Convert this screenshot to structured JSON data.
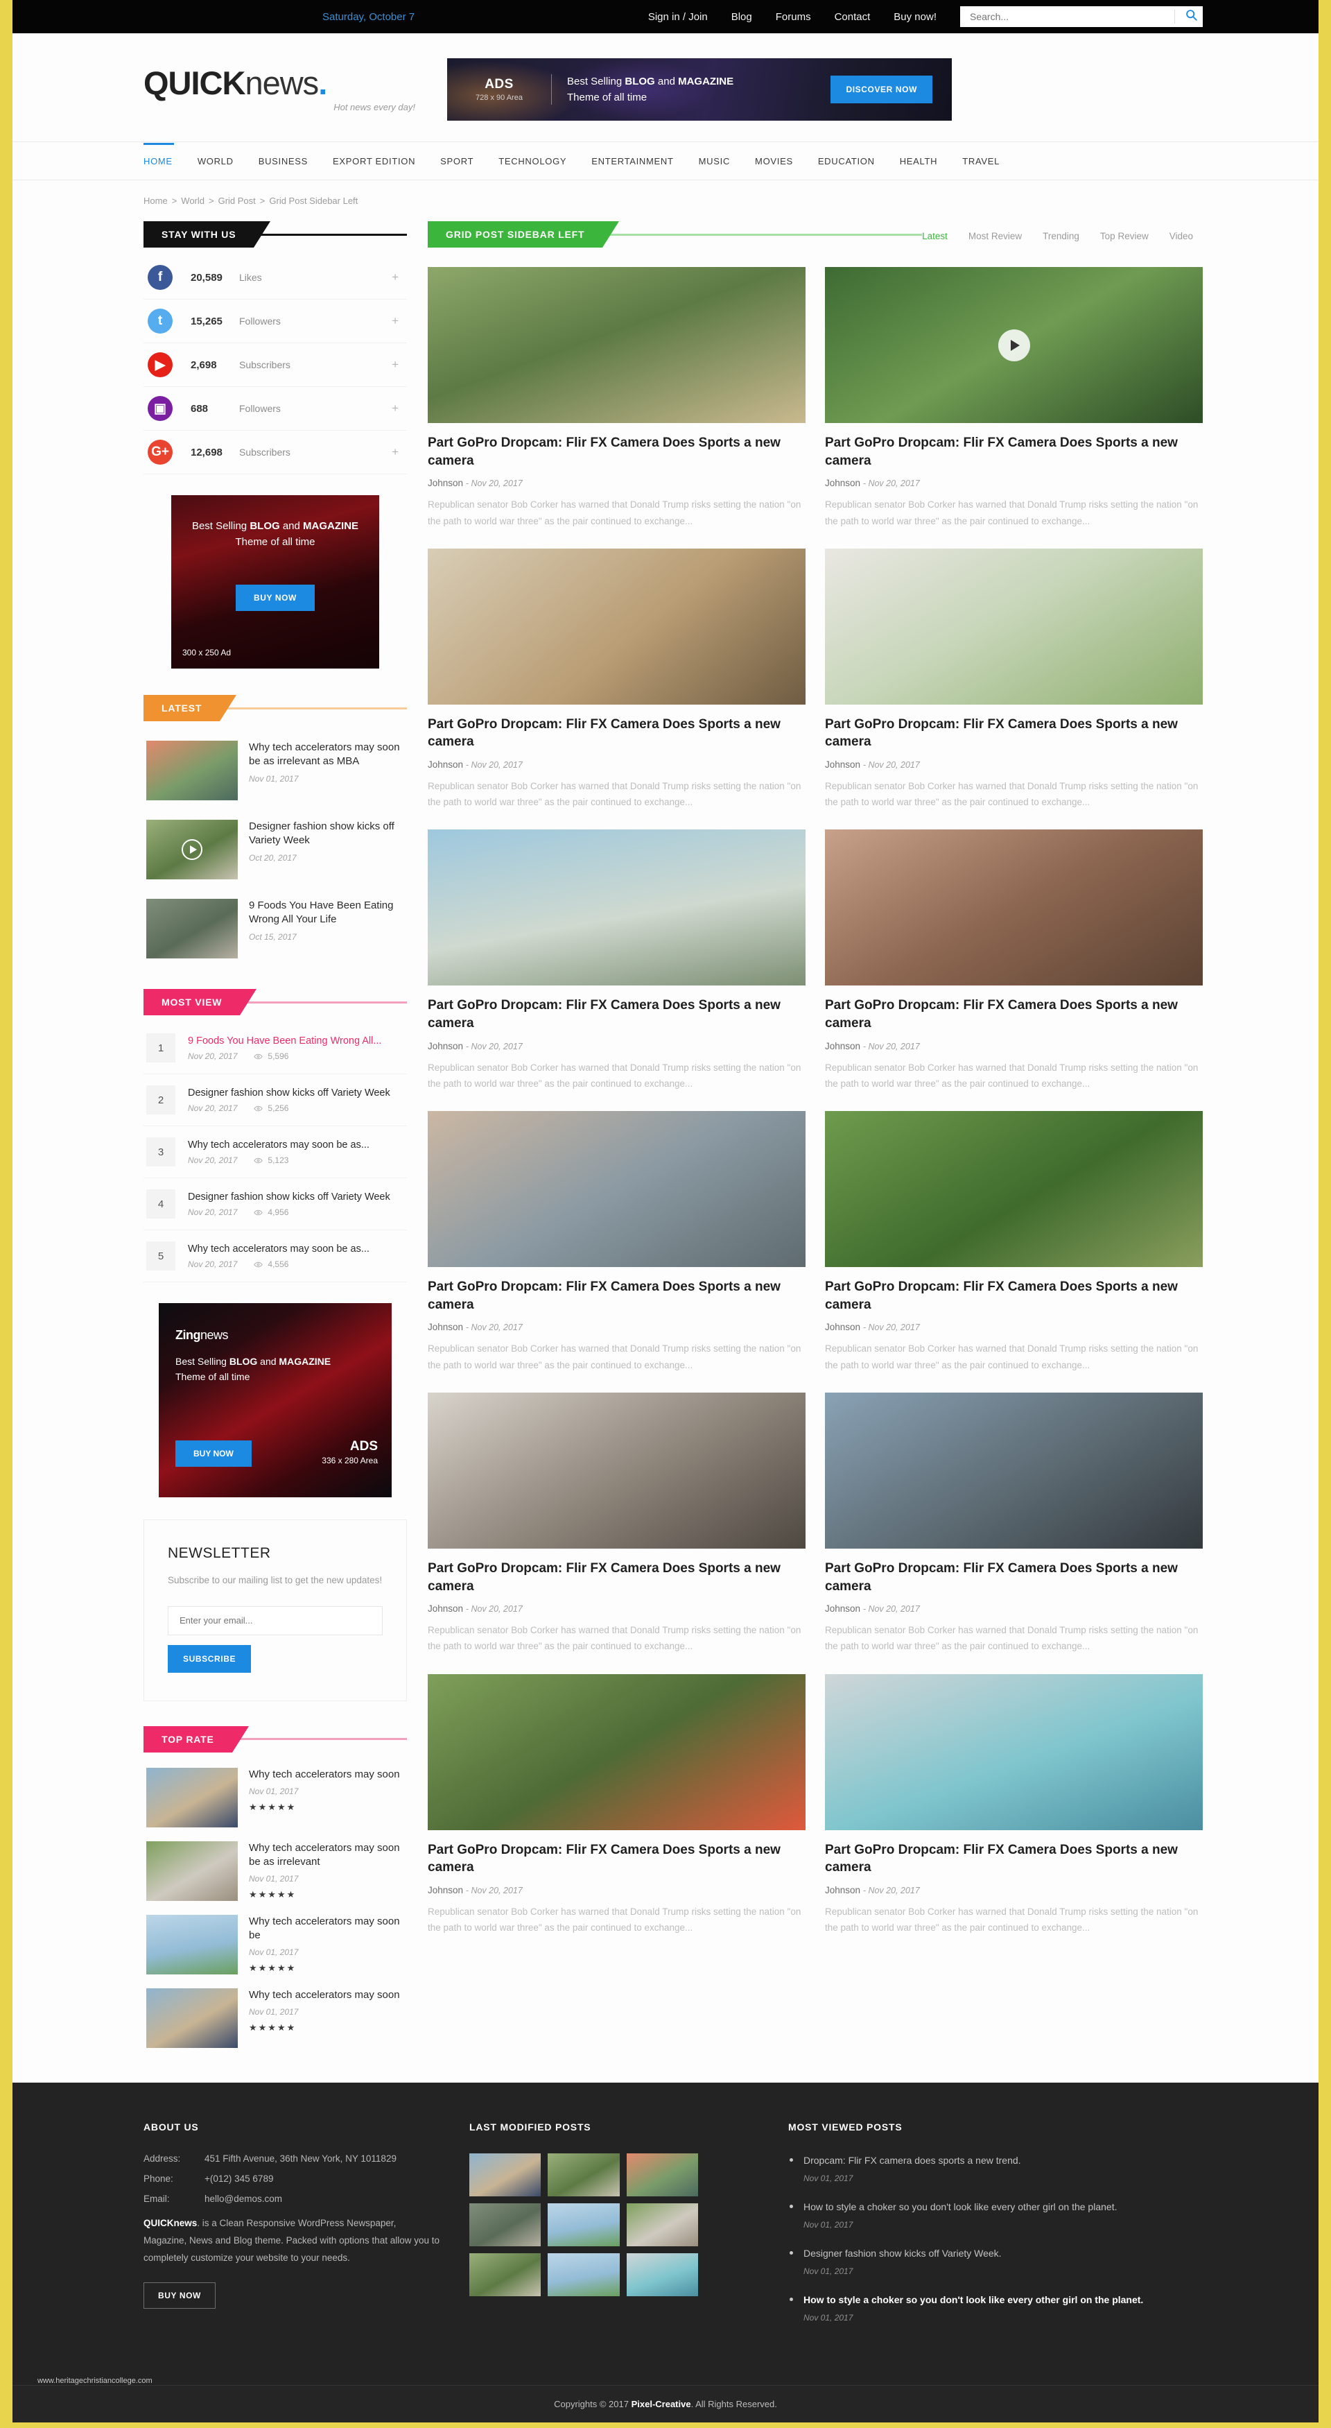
{
  "topbar": {
    "date": "Saturday, October 7",
    "links": [
      "Sign in / Join",
      "Blog",
      "Forums",
      "Contact",
      "Buy now!"
    ],
    "search_placeholder": "Search...",
    "search_value": ""
  },
  "header": {
    "logo_bold": "QUICK",
    "logo_light": "news",
    "logo_dot": ".",
    "tagline": "Hot news every day!",
    "banner": {
      "ads_label": "ADS",
      "ads_size": "728 x 90 Area",
      "line1_pre": "Best Selling ",
      "line1_b1": "BLOG",
      "line1_mid": " and ",
      "line1_b2": "MAGAZINE",
      "line2": "Theme of all time",
      "cta": "DISCOVER NOW"
    }
  },
  "nav": {
    "items": [
      "HOME",
      "WORLD",
      "BUSINESS",
      "EXPORT EDITION",
      "SPORT",
      "TECHNOLOGY",
      "ENTERTAINMENT",
      "MUSIC",
      "MOVIES",
      "EDUCATION",
      "HEALTH",
      "TRAVEL"
    ],
    "active": "HOME"
  },
  "breadcrumb": [
    "Home",
    "World",
    "Grid Post",
    "Grid Post Sidebar Left"
  ],
  "sidebar": {
    "stay_with_us": {
      "title": "STAY WITH US",
      "items": [
        {
          "icon": "facebook-icon",
          "glyph": "f",
          "color": "#3b5998",
          "count": "20,589",
          "label": "Likes",
          "action": "+"
        },
        {
          "icon": "twitter-icon",
          "glyph": "t",
          "color": "#55acee",
          "count": "15,265",
          "label": "Followers",
          "action": "+"
        },
        {
          "icon": "youtube-icon",
          "glyph": "▶",
          "color": "#e62117",
          "count": "2,698",
          "label": "Subscribers",
          "action": "+"
        },
        {
          "icon": "instagram-icon",
          "glyph": "▣",
          "color": "#7b1fa2",
          "count": "688",
          "label": "Followers",
          "action": "+"
        },
        {
          "icon": "google-plus-icon",
          "glyph": "G+",
          "color": "#e8442f",
          "count": "12,698",
          "label": "Subscribers",
          "action": "+"
        }
      ]
    },
    "ad300": {
      "line1_pre": "Best Selling ",
      "line1_b1": "BLOG",
      "line1_mid": " and ",
      "line1_b2": "MAGAZINE",
      "line2": "Theme of all time",
      "cta": "BUY NOW",
      "size": "300 x 250 Ad"
    },
    "latest": {
      "title": "LATEST",
      "items": [
        {
          "title": "Why tech accelerators may soon be as irrelevant as MBA",
          "date": "Nov 01, 2017",
          "video": false
        },
        {
          "title": "Designer fashion show kicks off Variety Week",
          "date": "Oct 20, 2017",
          "video": true
        },
        {
          "title": "9 Foods You Have Been Eating Wrong All Your Life",
          "date": "Oct 15, 2017",
          "video": false
        }
      ]
    },
    "most_view": {
      "title": "MOST VIEW",
      "items": [
        {
          "rank": "1",
          "title": "9 Foods You Have Been Eating Wrong All...",
          "date": "Nov 20, 2017",
          "views": "5,596",
          "hot": true
        },
        {
          "rank": "2",
          "title": "Designer fashion show kicks off Variety Week",
          "date": "Nov 20, 2017",
          "views": "5,256",
          "hot": false
        },
        {
          "rank": "3",
          "title": "Why tech accelerators may soon be as...",
          "date": "Nov 20, 2017",
          "views": "5,123",
          "hot": false
        },
        {
          "rank": "4",
          "title": "Designer fashion show kicks off Variety Week",
          "date": "Nov 20, 2017",
          "views": "4,956",
          "hot": false
        },
        {
          "rank": "5",
          "title": "Why tech accelerators may soon be as...",
          "date": "Nov 20, 2017",
          "views": "4,556",
          "hot": false
        }
      ]
    },
    "ad_zing": {
      "logo_bold": "Zing",
      "logo_light": "news",
      "line1_pre": "Best Selling ",
      "line1_b1": "BLOG",
      "line1_mid": " and ",
      "line1_b2": "MAGAZINE",
      "line2": "Theme of all time",
      "cta": "BUY NOW",
      "ads_label": "ADS",
      "ads_size": "336 x 280 Area"
    },
    "newsletter": {
      "title": "NEWSLETTER",
      "desc": "Subscribe to our mailing list to get the new updates!",
      "placeholder": "Enter your email...",
      "value": "",
      "button": "SUBSCRIBE"
    },
    "top_rate": {
      "title": "TOP RATE",
      "items": [
        {
          "title": "Why tech accelerators may soon",
          "date": "Nov 01, 2017",
          "stars": "★★★★★"
        },
        {
          "title": "Why tech accelerators may soon be as irrelevant",
          "date": "Nov 01, 2017",
          "stars": "★★★★★"
        },
        {
          "title": "Why tech accelerators may soon be",
          "date": "Nov 01, 2017",
          "stars": "★★★★★"
        },
        {
          "title": "Why tech accelerators may soon",
          "date": "Nov 01, 2017",
          "stars": "★★★★★"
        }
      ]
    }
  },
  "main": {
    "section_title": "GRID POST SIDEBAR LEFT",
    "tabs": [
      "Latest",
      "Most Review",
      "Trending",
      "Top Review",
      "Video"
    ],
    "active_tab": "Latest",
    "posts": [
      {
        "title": "Part GoPro Dropcam: Flir FX Camera Does Sports a new camera",
        "author": "Johnson",
        "date": "Nov 20, 2017",
        "excerpt": "Republican senator Bob Corker has warned that Donald Trump risks setting the nation \"on the path to world war three\" as the pair continued to exchange...",
        "video": false,
        "img": "runner"
      },
      {
        "title": "Part GoPro Dropcam: Flir FX Camera Does Sports a new camera",
        "author": "Johnson",
        "date": "Nov 20, 2017",
        "excerpt": "Republican senator Bob Corker has warned that Donald Trump risks setting the nation \"on the path to world war three\" as the pair continued to exchange...",
        "video": true,
        "img": "football"
      },
      {
        "title": "Part GoPro Dropcam: Flir FX Camera Does Sports a new camera",
        "author": "Johnson",
        "date": "Nov 20, 2017",
        "excerpt": "Republican senator Bob Corker has warned that Donald Trump risks setting the nation \"on the path to world war three\" as the pair continued to exchange...",
        "video": false,
        "img": "classroom"
      },
      {
        "title": "Part GoPro Dropcam: Flir FX Camera Does Sports a new camera",
        "author": "Johnson",
        "date": "Nov 20, 2017",
        "excerpt": "Republican senator Bob Corker has warned that Donald Trump risks setting the nation \"on the path to world war three\" as the pair continued to exchange...",
        "video": false,
        "img": "sofa"
      },
      {
        "title": "Part GoPro Dropcam: Flir FX Camera Does Sports a new camera",
        "author": "Johnson",
        "date": "Nov 20, 2017",
        "excerpt": "Republican senator Bob Corker has warned that Donald Trump risks setting the nation \"on the path to world war three\" as the pair continued to exchange...",
        "video": false,
        "img": "pelican"
      },
      {
        "title": "Part GoPro Dropcam: Flir FX Camera Does Sports a new camera",
        "author": "Johnson",
        "date": "Nov 20, 2017",
        "excerpt": "Republican senator Bob Corker has warned that Donald Trump risks setting the nation \"on the path to world war three\" as the pair continued to exchange...",
        "video": false,
        "img": "hands"
      },
      {
        "title": "Part GoPro Dropcam: Flir FX Camera Does Sports a new camera",
        "author": "Johnson",
        "date": "Nov 20, 2017",
        "excerpt": "Republican senator Bob Corker has warned that Donald Trump risks setting the nation \"on the path to world war three\" as the pair continued to exchange...",
        "video": false,
        "img": "couple"
      },
      {
        "title": "Part GoPro Dropcam: Flir FX Camera Does Sports a new camera",
        "author": "Johnson",
        "date": "Nov 20, 2017",
        "excerpt": "Republican senator Bob Corker has warned that Donald Trump risks setting the nation \"on the path to world war three\" as the pair continued to exchange...",
        "video": false,
        "img": "rugby"
      },
      {
        "title": "Part GoPro Dropcam: Flir FX Camera Does Sports a new camera",
        "author": "Johnson",
        "date": "Nov 20, 2017",
        "excerpt": "Republican senator Bob Corker has warned that Donald Trump risks setting the nation \"on the path to world war three\" as the pair continued to exchange...",
        "video": false,
        "img": "robot"
      },
      {
        "title": "Part GoPro Dropcam: Flir FX Camera Does Sports a new camera",
        "author": "Johnson",
        "date": "Nov 20, 2017",
        "excerpt": "Republican senator Bob Corker has warned that Donald Trump risks setting the nation \"on the path to world war three\" as the pair continued to exchange...",
        "video": false,
        "img": "violin"
      },
      {
        "title": "Part GoPro Dropcam: Flir FX Camera Does Sports a new camera",
        "author": "Johnson",
        "date": "Nov 20, 2017",
        "excerpt": "Republican senator Bob Corker has warned that Donald Trump risks setting the nation \"on the path to world war three\" as the pair continued to exchange...",
        "video": false,
        "img": "shoe"
      },
      {
        "title": "Part GoPro Dropcam: Flir FX Camera Does Sports a new camera",
        "author": "Johnson",
        "date": "Nov 20, 2017",
        "excerpt": "Republican senator Bob Corker has warned that Donald Trump risks setting the nation \"on the path to world war three\" as the pair continued to exchange...",
        "video": false,
        "img": "beach"
      }
    ]
  },
  "footer": {
    "about": {
      "title": "ABOUT US",
      "address_key": "Address:",
      "address_val": "451 Fifth Avenue, 36th New York, NY 1011829",
      "phone_key": "Phone:",
      "phone_val": "+(012) 345 6789",
      "email_key": "Email:",
      "email_val": "hello@demos.com",
      "desc_b": "QUICKnews",
      "desc_rest": ". is a Clean Responsive WordPress Newspaper, Magazine, News and Blog theme. Packed with options that allow you to completely customize your website to your needs.",
      "cta": "BUY NOW"
    },
    "last_modified": {
      "title": "LAST MODIFIED POSTS",
      "count": 9
    },
    "most_viewed": {
      "title": "MOST VIEWED POSTS",
      "items": [
        {
          "title": "Dropcam: Flir FX camera does sports a new trend.",
          "date": "Nov 01, 2017",
          "hi": false
        },
        {
          "title": "How to style a choker so you don't look like every other girl on the planet.",
          "date": "Nov 01, 2017",
          "hi": false
        },
        {
          "title": "Designer fashion show kicks off Variety Week.",
          "date": "Nov 01, 2017",
          "hi": false
        },
        {
          "title": "How to style a choker so you don't look like every other girl on the planet.",
          "date": "Nov 01, 2017",
          "hi": true
        }
      ]
    },
    "watermark": "www.heritagechristiancollege.com",
    "copyright_pre": "Copyrights © 2017 ",
    "copyright_b": "Pixel-Creative",
    "copyright_post": ". All Rights Reserved."
  },
  "colors": {
    "accent_blue": "#1c8ae0",
    "green": "#3cb53c",
    "pink": "#ee2a69",
    "orange": "#f0922f",
    "page_border": "#e8d44d"
  }
}
